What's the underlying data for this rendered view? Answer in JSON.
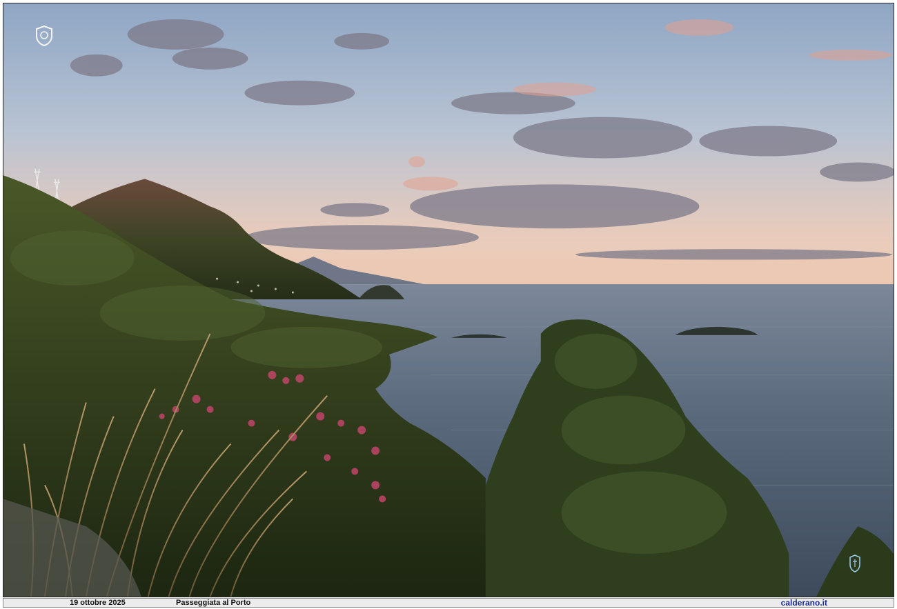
{
  "footer": {
    "date": "19 ottobre 2025",
    "title": "Passeggiata al Porto",
    "site": "calderano.it"
  },
  "icons": {
    "crest": "crest-watermark-icon",
    "corner": "coat-of-arms-icon"
  },
  "colors": {
    "sky_top": "#8fa6c4",
    "sky_horizon": "#f2cdb4",
    "sea": "#4f5f72",
    "hill": "#2c3a1c",
    "flowers": "#c2456a",
    "site_link": "#1a2b8c"
  }
}
